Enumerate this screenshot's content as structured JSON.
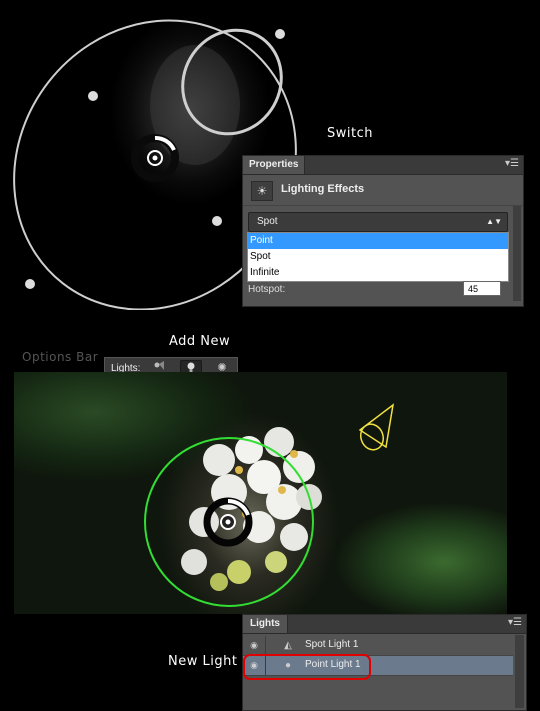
{
  "callouts": {
    "switch": "Switch",
    "add_new": "Add New",
    "options_bar": "Options Bar",
    "new_light": "New Light"
  },
  "properties_panel": {
    "tab": "Properties",
    "menu_icon": "panel-menu-icon",
    "title": "Lighting Effects",
    "light_type_selected": "Spot",
    "dropdown_options": [
      "Point",
      "Spot",
      "Infinite"
    ],
    "highlighted_option": "Point",
    "hotspot_label": "Hotspot:",
    "hotspot_value": "45"
  },
  "options_bar": {
    "label": "Lights:",
    "buttons": [
      "spot-light-icon",
      "point-light-icon",
      "infinite-light-icon"
    ],
    "active_button": "point-light-icon"
  },
  "lights_panel": {
    "tab": "Lights",
    "items": [
      {
        "name": "Spot Light 1",
        "icon": "spot-light-icon",
        "selected": false
      },
      {
        "name": "Point Light 1",
        "icon": "point-light-icon",
        "selected": true
      }
    ]
  },
  "colors": {
    "panel_bg": "#535353",
    "selection_blue": "#3399ff",
    "highlight_red": "#e00000",
    "point_light_ring": "#33dd33",
    "spot_cone": "#f0e040"
  }
}
